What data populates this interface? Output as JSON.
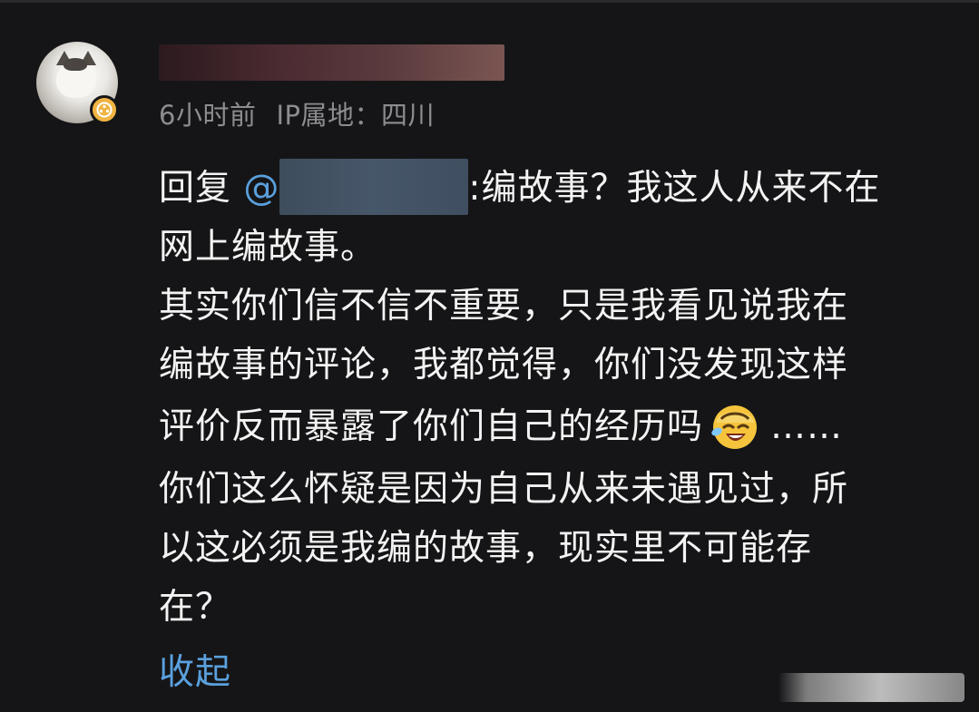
{
  "comment": {
    "meta": {
      "time": "6小时前",
      "location": "IP属地：四川"
    },
    "reply_prefix": "回复 ",
    "mention_at": "@",
    "lines": {
      "l1_after": ":编故事？我这人从来不在",
      "l2": "网上编故事。",
      "l3": "其实你们信不信不重要，只是我看见说我在",
      "l4": "编故事的评论，我都觉得，你们没发现这样",
      "l5_before": "评价反而暴露了你们自己的经历吗",
      "l5_after": "……",
      "l6": "你们这么怀疑是因为自己从来未遇见过，所",
      "l7": "以这必须是我编的故事，现实里不可能存",
      "l8": "在？"
    },
    "emoji": "laughing-tears-emoji",
    "collapse_label": "收起"
  },
  "colors": {
    "background": "#151517",
    "text": "#f3f3f3",
    "meta": "#8d8d90",
    "link": "#5aa0dd",
    "badge": "#f0b443"
  }
}
